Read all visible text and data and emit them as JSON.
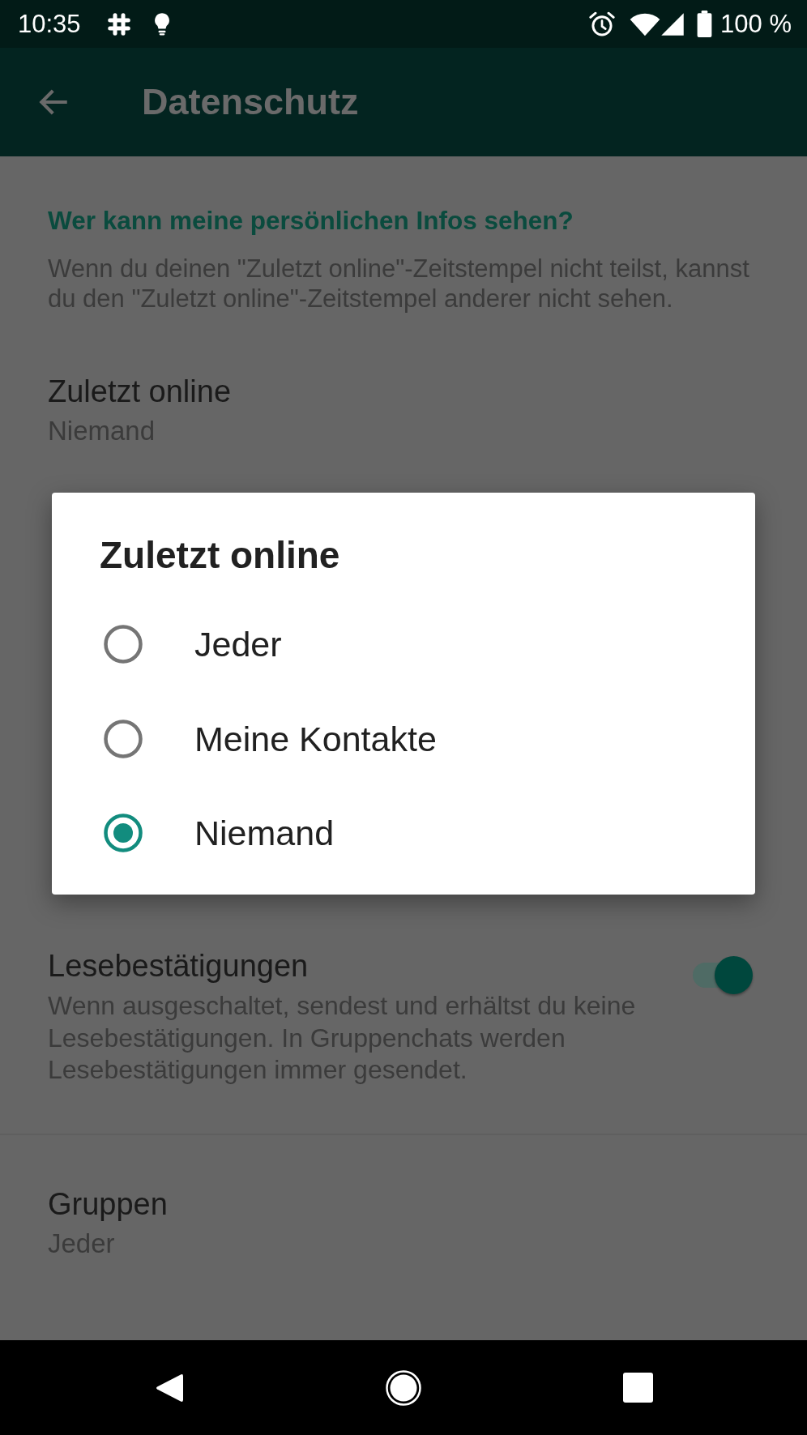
{
  "status_bar": {
    "time": "10:35",
    "battery": "100 %"
  },
  "app_bar": {
    "title": "Datenschutz"
  },
  "section": {
    "title": "Wer kann meine persönlichen Infos sehen?",
    "description": "Wenn du deinen \"Zuletzt online\"-Zeitstempel nicht teilst, kannst du den \"Zuletzt online\"-Zeitstempel anderer nicht sehen.",
    "rows": [
      {
        "title": "Zuletzt online",
        "value": "Niemand"
      }
    ]
  },
  "read_receipts": {
    "title": "Lesebestätigungen",
    "description": "Wenn ausgeschaltet, sendest und erhältst du keine Lesebestätigungen. In Gruppenchats werden Lesebestätigungen immer gesendet.",
    "on": true
  },
  "more_settings": [
    {
      "title": "Gruppen",
      "value": "Jeder"
    }
  ],
  "dialog": {
    "title": "Zuletzt online",
    "options": [
      {
        "label": "Jeder",
        "selected": false
      },
      {
        "label": "Meine Kontakte",
        "selected": false
      },
      {
        "label": "Niemand",
        "selected": true
      }
    ]
  }
}
